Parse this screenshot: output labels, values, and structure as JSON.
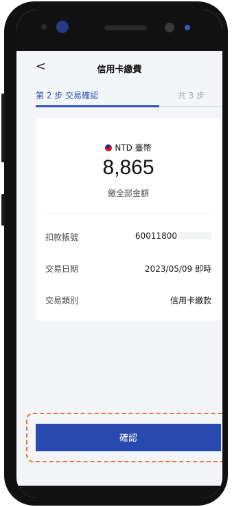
{
  "header": {
    "back_icon": "chevron-left-icon",
    "back_glyph": "<",
    "title": "信用卡繳費"
  },
  "stepper": {
    "current": "第 2 步 交易確認",
    "total": "共 3 步",
    "progress_fraction": 0.67
  },
  "payment": {
    "currency": "NTD 臺幣",
    "amount": "8,865",
    "amount_label": "繳全部金額",
    "rows": [
      {
        "label": "扣款帳號",
        "value": "60011800"
      },
      {
        "label": "交易日期",
        "value": "2023/05/09 即時"
      },
      {
        "label": "交易類別",
        "value": "信用卡繳款"
      }
    ]
  },
  "actions": {
    "confirm_label": "確認"
  },
  "colors": {
    "accent": "#2849b0",
    "highlight": "#ea7333",
    "background": "#f3f5f8"
  }
}
